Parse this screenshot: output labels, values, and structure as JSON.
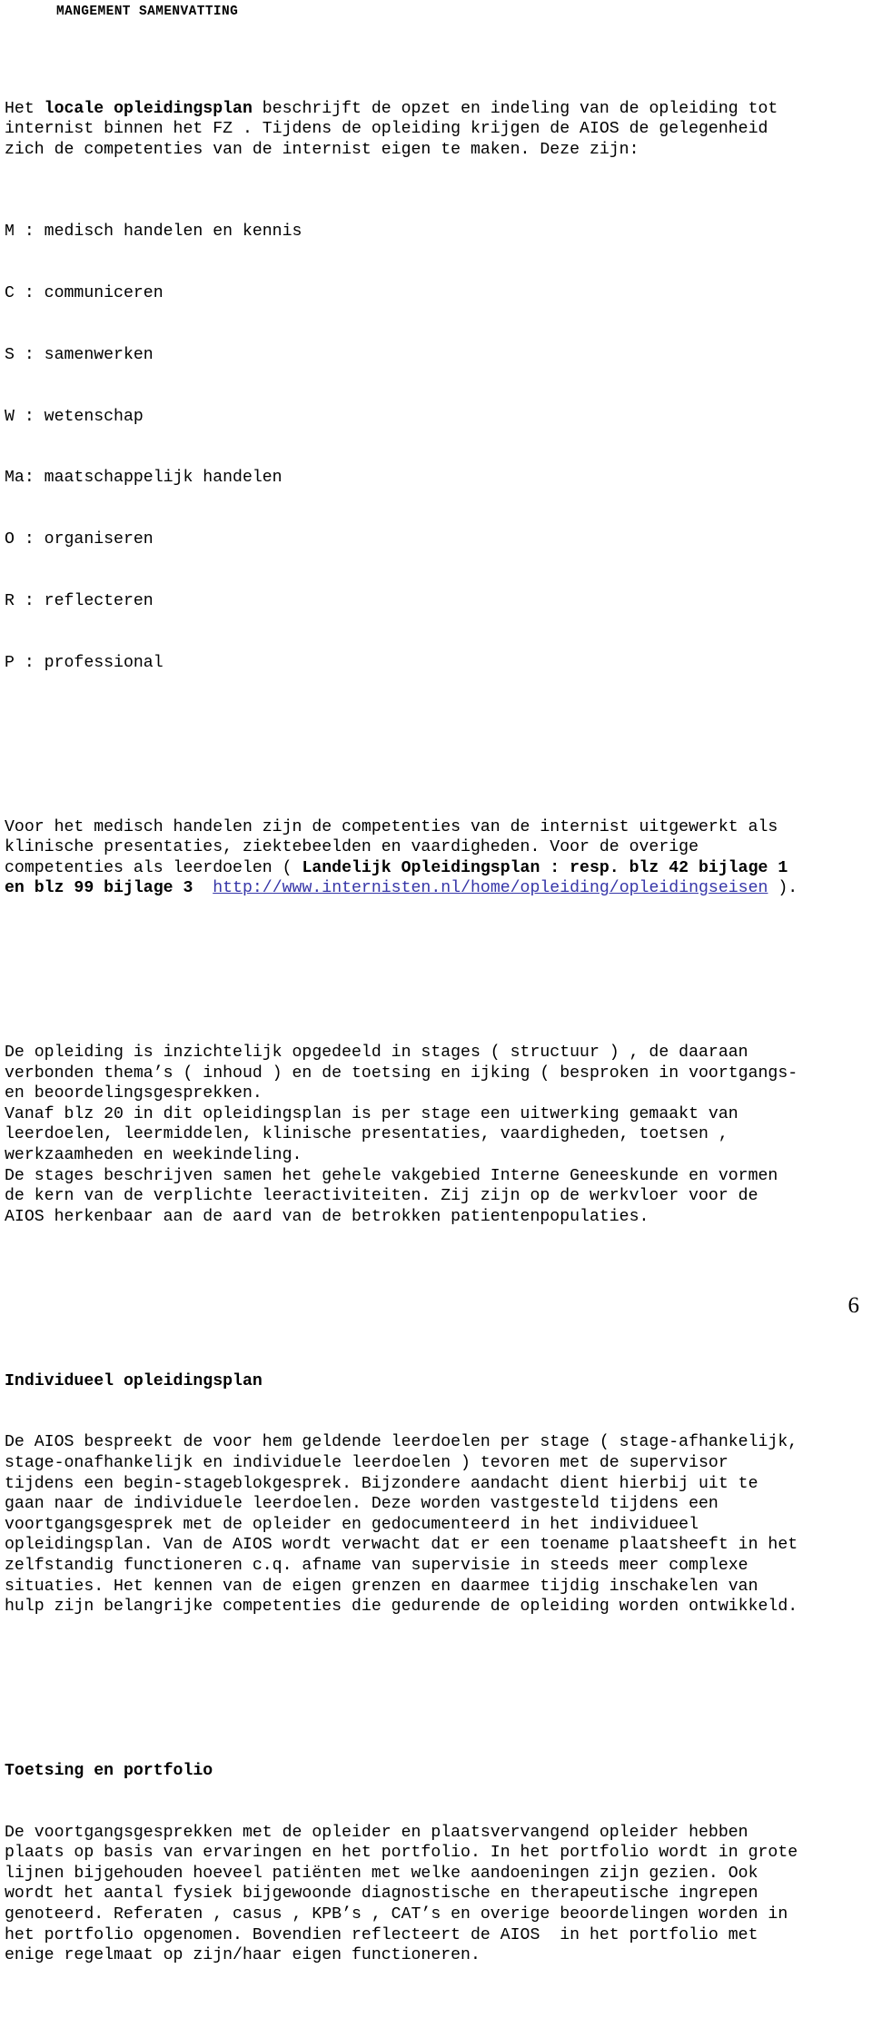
{
  "document": {
    "running_head": "MANGEMENT SAMENVATTING",
    "page_number": "6",
    "link_color": "#3636a8",
    "text_color": "#000000",
    "background_color": "#ffffff"
  },
  "intro": {
    "line1_a": "Het ",
    "line1_bold": "locale opleidingsplan",
    "line1_b": " beschrijft de opzet en indeling van de opleiding tot\ninternist binnen het FZ . Tijdens de opleiding krijgen de AIOS de gelegenheid\nzich de competenties van de internist eigen te maken. Deze zijn:"
  },
  "competencies": [
    "M : medisch handelen en kennis",
    "C : communiceren",
    "S : samenwerken",
    "W : wetenschap",
    "Ma: maatschappelijk handelen",
    "O : organiseren",
    "R : reflecteren",
    "P : professional"
  ],
  "reference_paragraph": {
    "part1": "Voor het medisch handelen zijn de competenties van de internist uitgewerkt als\nklinische presentaties, ziektebeelden en vaardigheden. Voor de overige\ncompetenties als leerdoelen ( ",
    "bold1": "Landelijk Opleidingsplan : resp. blz 42 bijlage 1\nen blz 99 bijlage 3",
    "spacer": "  ",
    "url": "http://www.internisten.nl/home/opleiding/opleidingseisen",
    "part2": " )."
  },
  "structure_paragraph": {
    "text": "De opleiding is inzichtelijk opgedeeld in stages ( structuur ) , de daaraan\nverbonden thema’s ( inhoud ) en de toetsing en ijking ( besproken in voortgangs-\nen beoordelingsgesprekken.\nVanaf blz 20 in dit opleidingsplan is per stage een uitwerking gemaakt van\nleerdoelen, leermiddelen, klinische presentaties, vaardigheden, toetsen ,\nwerkzaamheden en weekindeling.\nDe stages beschrijven samen het gehele vakgebied Interne Geneeskunde en vormen\nde kern van de verplichte leeractiviteiten. Zij zijn op de werkvloer voor de\nAIOS herkenbaar aan de aard van de betrokken patientenpopulaties."
  },
  "section_individual": {
    "heading": "Individueel opleidingsplan",
    "body": "De AIOS bespreekt de voor hem geldende leerdoelen per stage ( stage-afhankelijk,\nstage-onafhankelijk en individuele leerdoelen ) tevoren met de supervisor\ntijdens een begin-stageblokgesprek. Bijzondere aandacht dient hierbij uit te\ngaan naar de individuele leerdoelen. Deze worden vastgesteld tijdens een\nvoortgangsgesprek met de opleider en gedocumenteerd in het individueel\nopleidingsplan. Van de AIOS wordt verwacht dat er een toename plaatsheeft in het\nzelfstandig functioneren c.q. afname van supervisie in steeds meer complexe\nsituaties. Het kennen van de eigen grenzen en daarmee tijdig inschakelen van\nhulp zijn belangrijke competenties die gedurende de opleiding worden ontwikkeld."
  },
  "section_assessment": {
    "heading": "Toetsing en portfolio",
    "body": "De voortgangsgesprekken met de opleider en plaatsvervangend opleider hebben\nplaats op basis van ervaringen en het portfolio. In het portfolio wordt in grote\nlijnen bijgehouden hoeveel patiënten met welke aandoeningen zijn gezien. Ook\nwordt het aantal fysiek bijgewoonde diagnostische en therapeutische ingrepen\ngenoteerd. Referaten , casus , KPB’s , CAT’s en overige beoordelingen worden in\nhet portfolio opgenomen. Bovendien reflecteert de AIOS  in het portfolio met\nenige regelmaat op zijn/haar eigen functioneren."
  }
}
